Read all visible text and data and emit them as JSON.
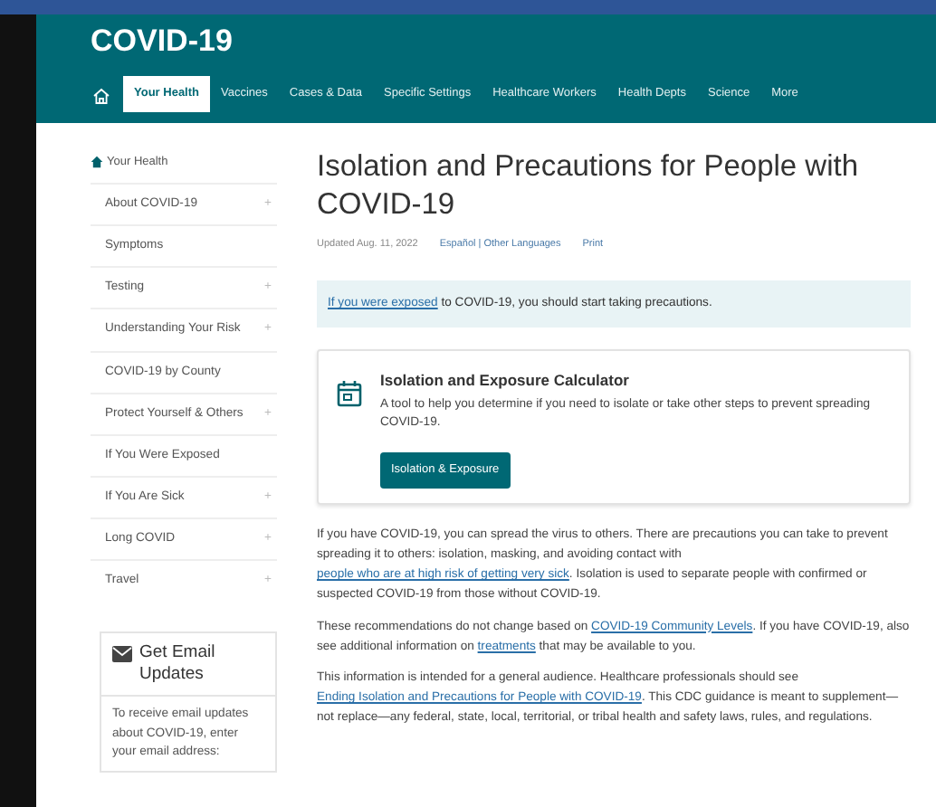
{
  "site_title": "COVID-19",
  "nav": [
    {
      "label": "Your Health",
      "selected": true
    },
    {
      "label": "Vaccines",
      "selected": false
    },
    {
      "label": "Cases & Data",
      "selected": false
    },
    {
      "label": "Specific Settings",
      "selected": false
    },
    {
      "label": "Healthcare Workers",
      "selected": false
    },
    {
      "label": "Health Depts",
      "selected": false
    },
    {
      "label": "Science",
      "selected": false
    },
    {
      "label": "More",
      "selected": false
    }
  ],
  "sidebar": {
    "heading": "Your Health",
    "items": [
      {
        "label": "About COVID-19",
        "expandable": true
      },
      {
        "label": "Symptoms",
        "expandable": false
      },
      {
        "label": "Testing",
        "expandable": true
      },
      {
        "label": "Understanding Your Risk",
        "expandable": true
      },
      {
        "label": "COVID-19 by County",
        "expandable": false
      },
      {
        "label": "Protect Yourself & Others",
        "expandable": true
      },
      {
        "label": "If You Were Exposed",
        "expandable": false
      },
      {
        "label": "If You Are Sick",
        "expandable": true
      },
      {
        "label": "Long COVID",
        "expandable": true
      },
      {
        "label": "Travel",
        "expandable": true
      }
    ],
    "plus_sign": "+"
  },
  "email_box": {
    "title": "Get Email Updates",
    "text": "To receive email updates about COVID-19, enter your email address:"
  },
  "page_title": "Isolation and Precautions for People with COVID-19",
  "meta": {
    "updated": "Updated Aug. 11, 2022",
    "languages": "Español | Other Languages",
    "print": "Print"
  },
  "alert": [
    {
      "text": "If you were exposed",
      "link": true
    },
    {
      "text": " to COVID-19, you should start taking precautions.",
      "link": false
    }
  ],
  "calculator": {
    "title": "Isolation and Exposure Calculator",
    "description": "A tool to help you determine if you need to isolate or take other steps to prevent spreading COVID-19.",
    "button": "Isolation & Exposure"
  },
  "paragraphs": [
    [
      {
        "text": "If you have COVID-19, you can spread the virus to others. There are precautions you can take to prevent spreading it to others: isolation, masking, and avoiding contact with ",
        "link": false
      },
      {
        "text": "people who are at high risk of getting very sick",
        "link": true
      },
      {
        "text": ". Isolation is used to separate people with confirmed or suspected COVID-19 from those without COVID-19.",
        "link": false
      }
    ],
    [
      {
        "text": "These recommendations do not change based on ",
        "link": false
      },
      {
        "text": "COVID-19 Community Levels",
        "link": true
      },
      {
        "text": ". If you have COVID-19, also see additional information on ",
        "link": false
      },
      {
        "text": "treatments",
        "link": true
      },
      {
        "text": " that may be available to you.",
        "link": false
      }
    ],
    [
      {
        "text": "This information is intended for a general audience. Healthcare professionals should see ",
        "link": false
      },
      {
        "text": "Ending Isolation and Precautions for People with COVID-19",
        "link": true
      },
      {
        "text": ". This CDC guidance is meant to supplement—not replace—any federal, state, local, territorial, or tribal health and safety laws, rules, and regulations.",
        "link": false
      }
    ]
  ]
}
